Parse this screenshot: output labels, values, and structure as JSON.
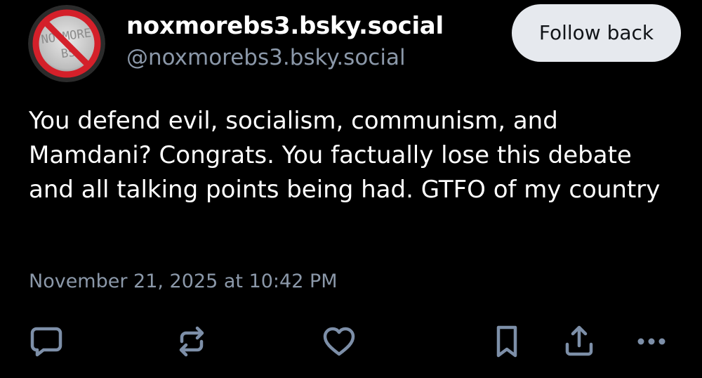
{
  "author": {
    "display_name": "noxmorebs3.bsky.social",
    "handle": "@noxmorebs3.bsky.social",
    "avatar_text_line1": "NO MORE",
    "avatar_text_line2": "BS"
  },
  "follow_button": {
    "label": "Follow back"
  },
  "post": {
    "text": "You defend evil, socialism, communism, and Mamdani? Congrats. You factually lose this debate and all talking points being had. GTFO of my country",
    "timestamp": "November 21, 2025 at 10:42 PM"
  },
  "actions": {
    "icons": [
      "reply-icon",
      "repost-icon",
      "like-icon",
      "bookmark-icon",
      "share-icon",
      "more-icon"
    ]
  },
  "colors": {
    "background": "#000000",
    "text_primary": "#ffffff",
    "text_secondary": "#8b98a9",
    "icon": "#7d8fa8",
    "button_bg": "#e6e9ee",
    "avatar_ring": "#d4202a"
  }
}
